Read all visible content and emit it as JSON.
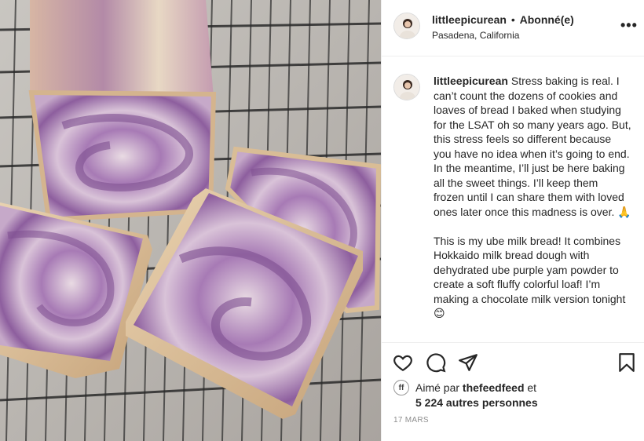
{
  "post": {
    "username": "littleepicurean",
    "dot": "•",
    "follow_label": "Abonné(e)",
    "location": "Pasadena, California",
    "more_label": "•••"
  },
  "caption": {
    "username": "littleepicurean",
    "text": "Stress baking is real. I can’t count the dozens of cookies and loaves of bread I baked when studying for the LSAT oh so many years ago. But, this stress feels so different because you have no idea when it’s going to end.\nIn the meantime, I’ll just be here baking all the sweet things. I’ll keep them frozen until I can share them with loved ones later once this madness is over. 🙏\n\nThis is my ube milk bread! It combines Hokkaido milk bread dough with dehydrated ube purple yam powder to create a soft fluffy colorful loaf! I’m making a chocolate milk version tonight 😊"
  },
  "actions": {
    "like_icon": "heart-icon",
    "comment_icon": "comment-icon",
    "share_icon": "paper-plane-icon",
    "save_icon": "bookmark-icon"
  },
  "likes": {
    "mini_avatar_text": "ff",
    "liked_by_prefix": "Aimé par",
    "liked_by_user": "thefeedfeed",
    "liked_by_suffix": "et",
    "others": "5 224 autres personnes"
  },
  "date": "17 MARS",
  "colors": {
    "ube_purple": "#8d5e9e",
    "crust": "#d8b98f",
    "text": "#262626",
    "muted": "#8e8e8e"
  }
}
